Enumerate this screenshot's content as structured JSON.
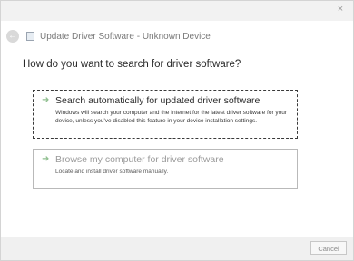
{
  "window": {
    "close_glyph": "×",
    "back_glyph": "←",
    "title": "Update Driver Software - Unknown Device"
  },
  "content": {
    "question": "How do you want to search for driver software?",
    "options": [
      {
        "label": "Search automatically for updated driver software",
        "description": "Windows will search your computer and the Internet for the latest driver software for your device, unless you've disabled this feature in your device installation settings.",
        "icon": "green-arrow-icon"
      },
      {
        "label": "Browse my computer for driver software",
        "description": "Locate and install driver software manually.",
        "icon": "green-arrow-icon"
      }
    ]
  },
  "footer": {
    "cancel_label": "Cancel"
  }
}
